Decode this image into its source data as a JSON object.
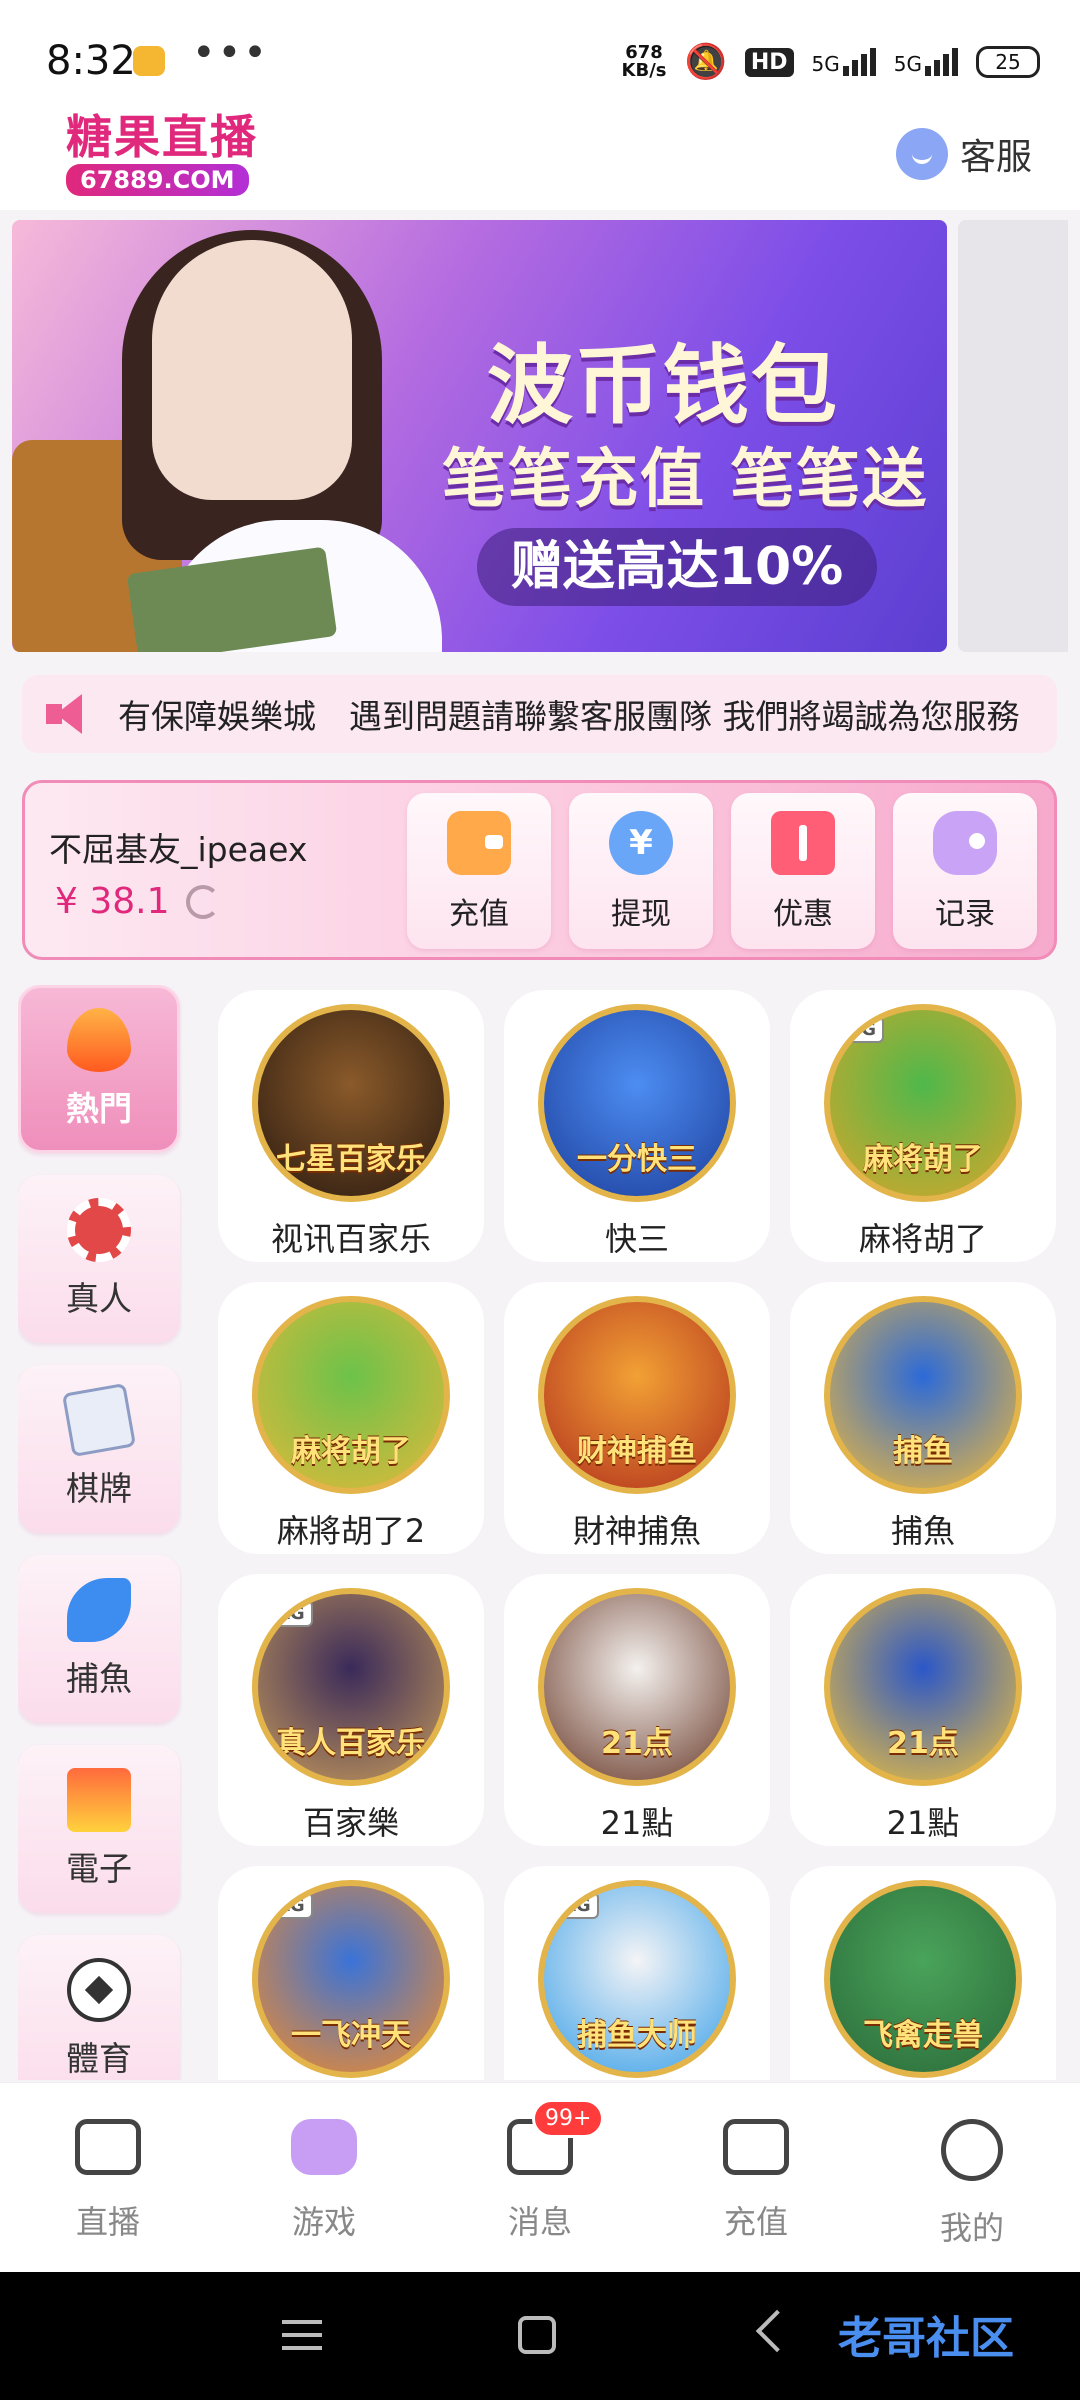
{
  "status_bar": {
    "time": "8:32",
    "more": "•••",
    "net_speed_value": "678",
    "net_speed_unit": "KB/s",
    "hd_label": "HD",
    "sim1": "5G",
    "sim2": "5G",
    "battery": "25"
  },
  "header": {
    "logo_title": "糖果直播",
    "logo_domain": "67889.COM",
    "service_label": "客服"
  },
  "banner": {
    "title": "波币钱包",
    "subtitle": "笔笔充值 笔笔送",
    "pill": "赠送高达10%",
    "page_count": 4,
    "active_index": 1
  },
  "marquee": {
    "text": "有保障娛樂城　遇到問題請聯繫客服團隊 我們將竭誠為您服務"
  },
  "account": {
    "username": "不屈基友_ipeaex",
    "balance": "¥ 38.1",
    "actions": [
      {
        "label": "充值",
        "icon": "wallet-icon"
      },
      {
        "label": "提现",
        "icon": "yen-icon"
      },
      {
        "label": "优惠",
        "icon": "ticket-icon"
      },
      {
        "label": "记录",
        "icon": "gamepad-icon"
      }
    ]
  },
  "side_nav": [
    {
      "label": "熱門",
      "icon": "fire-icon",
      "active": true
    },
    {
      "label": "真人",
      "icon": "chip-icon",
      "active": false
    },
    {
      "label": "棋牌",
      "icon": "cards-icon",
      "active": false
    },
    {
      "label": "捕魚",
      "icon": "shark-icon",
      "active": false
    },
    {
      "label": "電子",
      "icon": "slot-777-icon",
      "active": false
    },
    {
      "label": "體育",
      "icon": "soccer-ball-icon",
      "active": false
    }
  ],
  "games": [
    {
      "name": "视讯百家乐",
      "art_caption": "七星百家乐",
      "art_color": "#8a5a2a",
      "art_color2": "#2a1a10"
    },
    {
      "name": "快三",
      "art_caption": "一分快三",
      "art_color": "#4d8df2",
      "art_color2": "#1d3f9c"
    },
    {
      "name": "麻将胡了",
      "art_caption": "麻将胡了",
      "tag": "PG",
      "art_color": "#4fb84b",
      "art_color2": "#d8a62a"
    },
    {
      "name": "麻將胡了2",
      "art_caption": "麻将胡了",
      "art_color": "#6cc24a",
      "art_color2": "#e0b93a"
    },
    {
      "name": "財神捕魚",
      "art_caption": "财神捕鱼",
      "art_color": "#f2a135",
      "art_color2": "#b2311d"
    },
    {
      "name": "捕魚",
      "art_caption": "捕鱼",
      "art_color": "#2c6ad8",
      "art_color2": "#f0b93a"
    },
    {
      "name": "百家樂",
      "art_caption": "真人百家乐",
      "tag": "AG",
      "art_color": "#3a2a5a",
      "art_color2": "#c59a5a"
    },
    {
      "name": "21點",
      "art_caption": "21点",
      "art_color": "#f4f1ee",
      "art_color2": "#6a3a2a"
    },
    {
      "name": "21點",
      "art_caption": "21点",
      "art_color": "#2b57c8",
      "art_color2": "#f0c13a"
    },
    {
      "name": "",
      "art_caption": "一飞冲天",
      "tag": "AG",
      "art_color": "#3a73d8",
      "art_color2": "#f28b2a"
    },
    {
      "name": "",
      "art_caption": "捕鱼大师",
      "tag": "AG",
      "art_color": "#f4f4f6",
      "art_color2": "#3aa0e8"
    },
    {
      "name": "",
      "art_caption": "飞禽走兽",
      "art_color": "#4aa45a",
      "art_color2": "#2a6a3a"
    }
  ],
  "tab_bar": [
    {
      "label": "直播",
      "icon": "video-camera-icon",
      "active": false
    },
    {
      "label": "游戏",
      "icon": "gamepad-icon",
      "active": true
    },
    {
      "label": "消息",
      "icon": "chat-icon",
      "active": false,
      "badge": "99+"
    },
    {
      "label": "充值",
      "icon": "wallet-icon",
      "active": false
    },
    {
      "label": "我的",
      "icon": "face-icon",
      "active": false
    }
  ],
  "watermark": "老哥社区",
  "colors": {
    "accent": "#e0287c",
    "tab_active": "#c79ef4",
    "badge": "#ff3b3b"
  }
}
